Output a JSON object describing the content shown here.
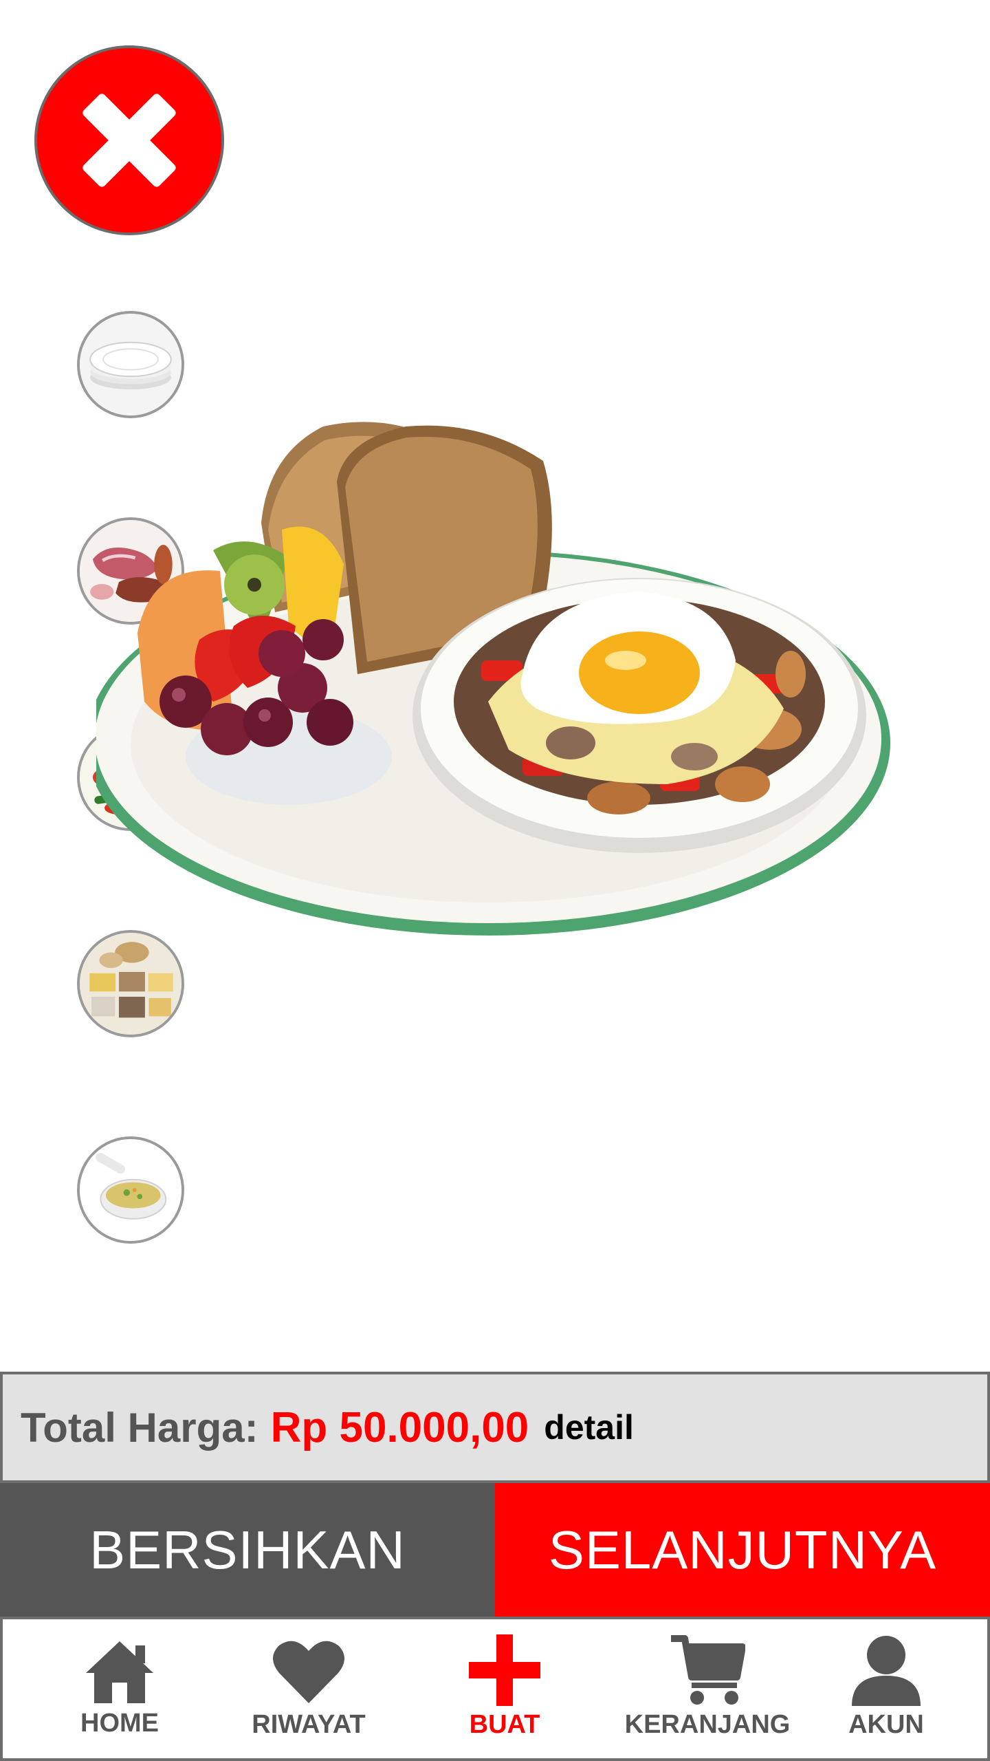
{
  "close_button": {
    "icon": "close-icon",
    "color": "#ff0000"
  },
  "categories": [
    {
      "name": "plate",
      "icon": "plate-icon"
    },
    {
      "name": "meat",
      "icon": "meat-icon"
    },
    {
      "name": "vegetables",
      "icon": "vegetables-icon"
    },
    {
      "name": "grains",
      "icon": "grains-icon"
    },
    {
      "name": "soup",
      "icon": "soup-icon"
    }
  ],
  "total": {
    "label": "Total Harga:",
    "value": "Rp 50.000,00",
    "detail_label": "detail"
  },
  "actions": {
    "clear_label": "BERSIHKAN",
    "next_label": "SELANJUTNYA"
  },
  "nav": {
    "items": [
      {
        "label": "HOME",
        "icon": "home-icon",
        "active": false
      },
      {
        "label": "RIWAYAT",
        "icon": "heart-icon",
        "active": false
      },
      {
        "label": "BUAT",
        "icon": "plus-icon",
        "active": true
      },
      {
        "label": "KERANJANG",
        "icon": "cart-icon",
        "active": false
      },
      {
        "label": "AKUN",
        "icon": "user-icon",
        "active": false
      }
    ]
  },
  "colors": {
    "accent": "#ff0000",
    "dark": "#555555",
    "bar_bg": "#e2e2e2"
  }
}
